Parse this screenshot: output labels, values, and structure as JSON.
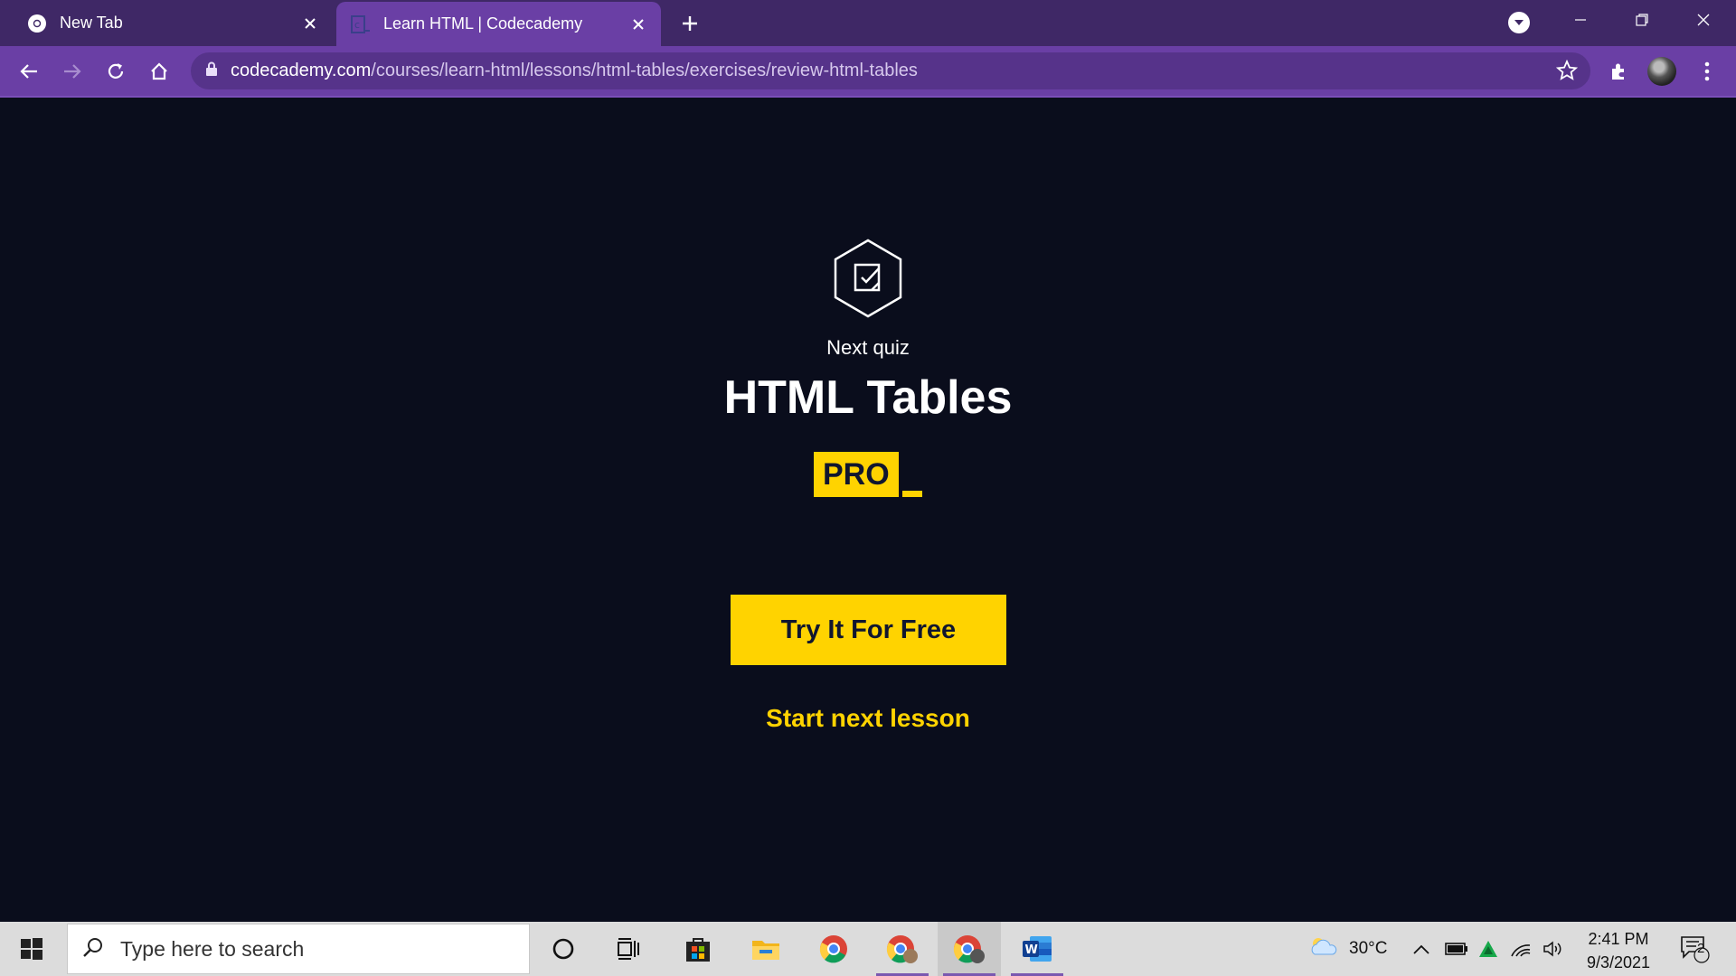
{
  "browser": {
    "tabs": [
      {
        "title": "New Tab",
        "favicon": "chrome-icon"
      },
      {
        "title": "Learn HTML | Codecademy",
        "favicon": "codecademy-icon",
        "active": true
      }
    ],
    "url": {
      "domain": "codecademy.com",
      "path": "/courses/learn-html/lessons/html-tables/exercises/review-html-tables"
    }
  },
  "page": {
    "kicker": "Next quiz",
    "title": "HTML Tables",
    "badge": "PRO",
    "cta_label": "Try It For Free",
    "next_lesson_label": "Start next lesson"
  },
  "taskbar": {
    "search_placeholder": "Type here to search",
    "weather": "30°C",
    "time": "2:41 PM",
    "date": "9/3/2021",
    "notifications": "2"
  },
  "colors": {
    "brand_yellow": "#ffd300",
    "page_bg": "#0a0d1c",
    "chrome_purple": "#6a3fa5"
  }
}
